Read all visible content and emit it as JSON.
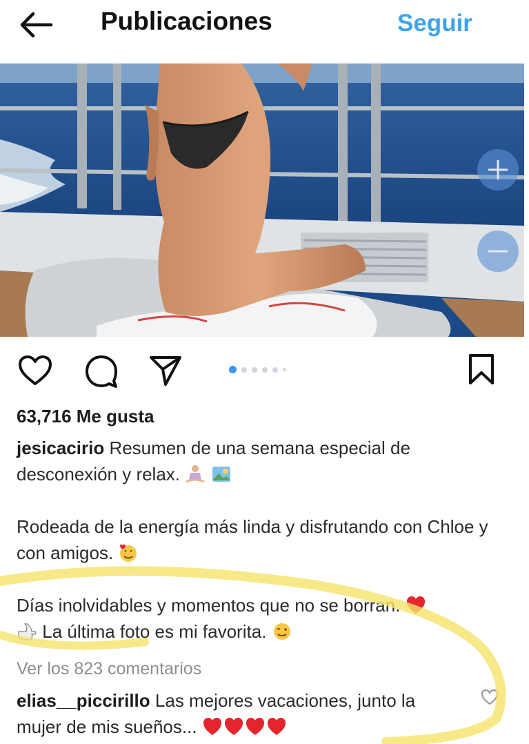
{
  "header": {
    "title": "Publicaciones",
    "follow_label": "Seguir",
    "back_icon": "arrow-left-icon"
  },
  "post": {
    "carousel": {
      "total": 6,
      "active_index": 0
    },
    "likes": "63,716 Me gusta",
    "caption": {
      "username": "jesicacirio",
      "line1": "Resumen de una semana especial de desconexión y relax.",
      "line2": "Rodeada de la energía más linda y disfrutando con Chloe y con amigos.",
      "line3": "Días inolvidables y momentos que no se borran.",
      "line4": "La última foto es mi favorita."
    },
    "view_comments": "Ver los 823 comentarios",
    "comment": {
      "username": "elias__piccirillo",
      "text": "Las mejores vacaciones, junto la mujer de mis sueños..."
    }
  },
  "colors": {
    "accent": "#3ea3ea",
    "highlight": "#f5e46a",
    "heart": "#e3262e"
  }
}
